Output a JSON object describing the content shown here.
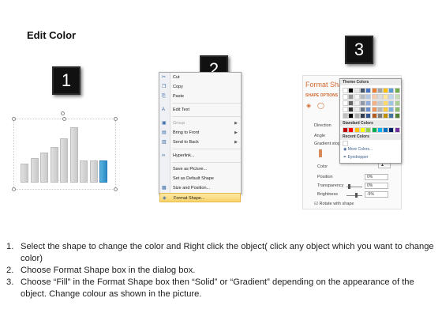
{
  "title": "Edit Color",
  "steps": {
    "one": "1",
    "two": "2",
    "three": "3"
  },
  "chart_bars": [
    {
      "value": 0.35,
      "selected": false
    },
    {
      "value": 0.45,
      "selected": false
    },
    {
      "value": 0.55,
      "selected": false
    },
    {
      "value": 0.65,
      "selected": false
    },
    {
      "value": 0.8,
      "selected": false
    },
    {
      "value": 1.0,
      "selected": false
    },
    {
      "value": 0.4,
      "selected": false
    },
    {
      "value": 0.4,
      "selected": false
    },
    {
      "value": 0.4,
      "selected": true
    }
  ],
  "context_menu": {
    "items": [
      {
        "label": "Cut",
        "icon": "scissors-icon",
        "disabled": false
      },
      {
        "label": "Copy",
        "icon": "copy-icon",
        "disabled": false
      },
      {
        "label": "Paste",
        "icon": "paste-icon",
        "disabled": false
      },
      {
        "label": "Edit Text",
        "icon": "edit-text-icon",
        "disabled": false
      },
      {
        "label": "Group",
        "icon": "group-icon",
        "disabled": true,
        "submenu": true
      },
      {
        "label": "Bring to Front",
        "icon": "bring-front-icon",
        "disabled": false,
        "submenu": true
      },
      {
        "label": "Send to Back",
        "icon": "send-back-icon",
        "disabled": false,
        "submenu": true
      },
      {
        "label": "Hyperlink...",
        "icon": "hyperlink-icon",
        "disabled": false
      },
      {
        "label": "Save as Picture...",
        "icon": "",
        "disabled": false
      },
      {
        "label": "Set as Default Shape",
        "icon": "",
        "disabled": false
      },
      {
        "label": "Size and Position...",
        "icon": "size-position-icon",
        "disabled": false
      },
      {
        "label": "Format Shape...",
        "icon": "format-shape-icon",
        "disabled": false,
        "highlighted": true
      }
    ]
  },
  "format_panel": {
    "title": "Format Shape",
    "tab": "SHAPE OPTIONS",
    "labels": {
      "direction": "Direction",
      "angle": "Angle",
      "gradient_stops": "Gradient stops",
      "color": "Color",
      "position": "Position",
      "transparency": "Transparency",
      "brightness": "Brightness",
      "rotate": "Rotate with shape"
    },
    "values": {
      "position": "0%",
      "transparency": "0%",
      "brightness": "-5%"
    }
  },
  "color_popup": {
    "theme_colors": "Theme Colors",
    "standard_colors": "Standard Colors",
    "recent_colors": "Recent Colors",
    "more_colors": "More Colors...",
    "eyedropper": "Eyedropper",
    "theme_palette": [
      "#ffffff",
      "#000000",
      "#e7e6e6",
      "#44546a",
      "#4472c4",
      "#ed7d31",
      "#a5a5a5",
      "#ffc000",
      "#5b9bd5",
      "#70ad47"
    ],
    "standard_palette": [
      "#c00000",
      "#ff0000",
      "#ffc000",
      "#ffff00",
      "#92d050",
      "#00b050",
      "#00b0f0",
      "#0070c0",
      "#002060",
      "#7030a0"
    ]
  },
  "instructions": [
    {
      "num": "1.",
      "text": "Select the shape to change the color and Right click the object( click any object which you want to change color)"
    },
    {
      "num": "2.",
      "text": "Choose Format Shape box in the dialog box."
    },
    {
      "num": "3.",
      "text": "Choose “Fill” in the Format Shape box then “Solid” or “Gradient” depending on the appearance of the object. Change colour as shown in the picture."
    }
  ]
}
